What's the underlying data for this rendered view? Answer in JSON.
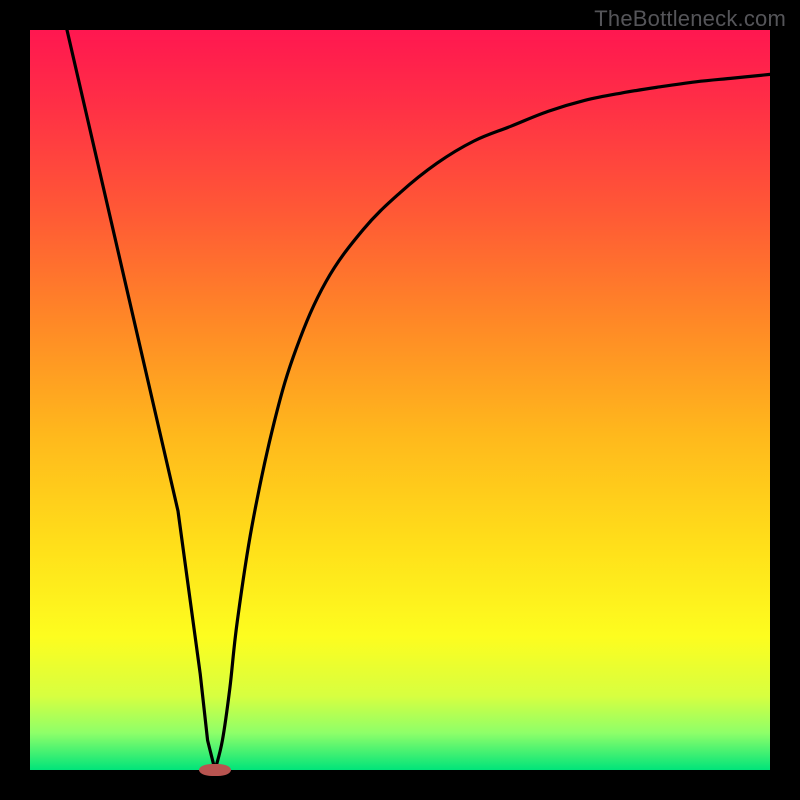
{
  "watermark": "TheBottleneck.com",
  "chart_data": {
    "type": "line",
    "title": "",
    "xlabel": "",
    "ylabel": "",
    "xlim": [
      0,
      100
    ],
    "ylim": [
      0,
      100
    ],
    "grid": false,
    "legend": false,
    "gradient_stops": [
      {
        "pos": 0.0,
        "color": "#ff1750"
      },
      {
        "pos": 0.1,
        "color": "#ff2f46"
      },
      {
        "pos": 0.25,
        "color": "#ff5a35"
      },
      {
        "pos": 0.4,
        "color": "#ff8a26"
      },
      {
        "pos": 0.55,
        "color": "#ffb91c"
      },
      {
        "pos": 0.7,
        "color": "#ffe01a"
      },
      {
        "pos": 0.82,
        "color": "#fdfd1f"
      },
      {
        "pos": 0.9,
        "color": "#d7ff40"
      },
      {
        "pos": 0.95,
        "color": "#8eff69"
      },
      {
        "pos": 1.0,
        "color": "#00e47a"
      }
    ],
    "series": [
      {
        "name": "bottleneck-curve",
        "color": "#000000",
        "x": [
          5,
          8,
          11,
          14,
          17,
          20,
          23,
          24,
          25,
          26,
          27,
          28,
          30,
          33,
          36,
          40,
          45,
          50,
          55,
          60,
          65,
          70,
          75,
          80,
          85,
          90,
          95,
          100
        ],
        "y": [
          100,
          87,
          74,
          61,
          48,
          35,
          13,
          4,
          0,
          4,
          11,
          20,
          33,
          47,
          57,
          66,
          73,
          78,
          82,
          85,
          87,
          89,
          90.5,
          91.5,
          92.3,
          93,
          93.5,
          94
        ]
      }
    ],
    "marker": {
      "x": 25,
      "y": 0,
      "width_pct": 4.2,
      "color": "#b85450",
      "name": "optimal-point"
    }
  }
}
